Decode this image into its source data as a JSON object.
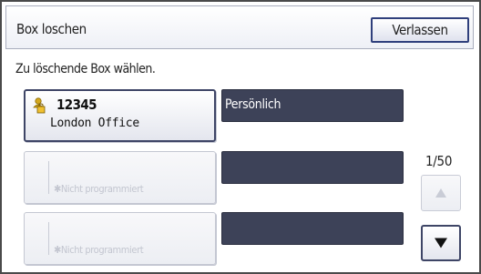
{
  "header": {
    "title": "Box loschen",
    "exit_label": "Verlassen"
  },
  "instruction": "Zu löschende Box wählen.",
  "boxes": [
    {
      "number": "12345",
      "name": "London Office",
      "type": "Persönlich",
      "icon": "user-lock-icon",
      "programmed": true
    },
    {
      "placeholder": "✱Nicht programmiert",
      "type": "",
      "programmed": false
    },
    {
      "placeholder": "✱Nicht programmiert",
      "type": "",
      "programmed": false
    }
  ],
  "pagination": {
    "page": "1/50",
    "up_icon": "arrow-up-icon",
    "down_icon": "arrow-down-icon"
  },
  "colors": {
    "frame_border": "#4a4a4a",
    "accent_border": "#2f3f7c",
    "dark_bar": "#3d4258",
    "disabled_text": "#c3c6d0",
    "lock_icon": "#c8a020"
  }
}
